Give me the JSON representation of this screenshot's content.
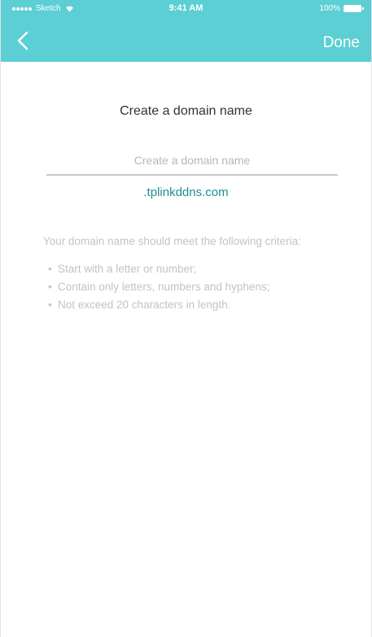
{
  "status_bar": {
    "carrier": "Sketch",
    "time": "9:41 AM",
    "battery": "100%"
  },
  "nav": {
    "back_icon": "chevron-left-icon",
    "done_label": "Done"
  },
  "title": "Create a domain name",
  "domain_input": {
    "value": "",
    "placeholder": "Create a domain name"
  },
  "domain_suffix": ".tplinkddns.com",
  "criteria": {
    "intro": "Your domain name should meet the following criteria:",
    "items": [
      "Start with a letter or number;",
      "Contain only letters, numbers and hyphens;",
      "Not exceed 20 characters in length."
    ]
  },
  "colors": {
    "header": "#5ccfd4",
    "suffix": "#1d8e96"
  }
}
